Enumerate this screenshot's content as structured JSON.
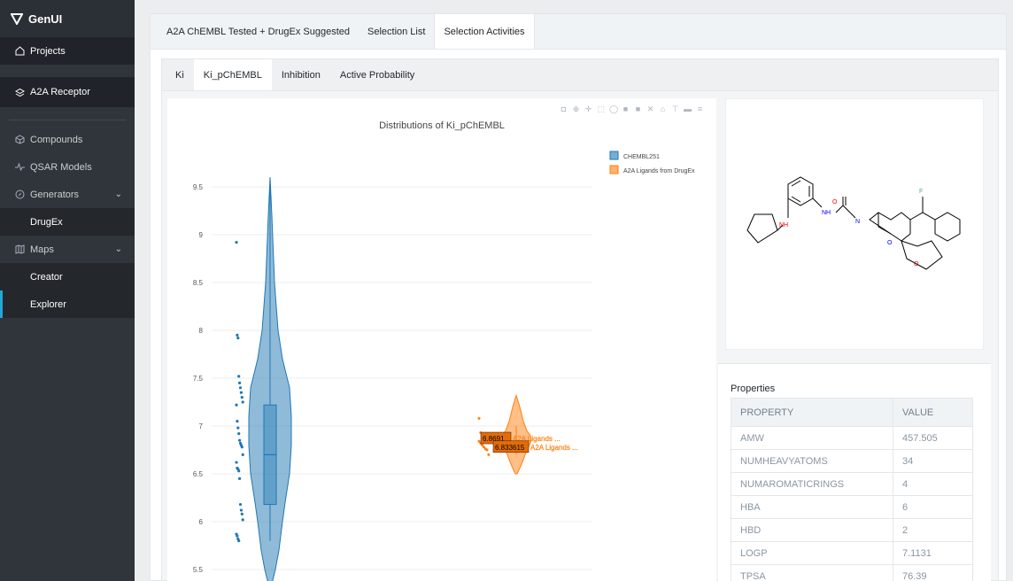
{
  "app": {
    "name": "GenUI"
  },
  "sidebar": {
    "projects": "Projects",
    "project_name": "A2A Receptor",
    "compounds": "Compounds",
    "qsar": "QSAR Models",
    "generators": "Generators",
    "drugex": "DrugEx",
    "maps": "Maps",
    "creator": "Creator",
    "explorer": "Explorer"
  },
  "tabs": [
    "A2A ChEMBL Tested + DrugEx Suggested",
    "Selection List",
    "Selection Activities"
  ],
  "subtabs": [
    "Ki",
    "Ki_pChEMBL",
    "Inhibition",
    "Active Probability"
  ],
  "icons": {
    "brand": "triangle-logo-icon",
    "projects": "home-icon",
    "project": "layers-icon",
    "compounds": "cube-icon",
    "qsar": "activity-icon",
    "generators": "compass-icon",
    "maps": "map-icon"
  },
  "colors": {
    "blue": "#1f77b4",
    "orange": "#ff7f0e",
    "accent": "#20a8d8"
  },
  "chart_data": {
    "type": "violin",
    "title": "Distributions of Ki_pChEMBL",
    "y_ticks": [
      "9.5",
      "9",
      "8.5",
      "8",
      "7.5",
      "7",
      "6.5",
      "6",
      "5.5"
    ],
    "legend": [
      "CHEMBL251",
      "A2A Ligands from DrugEx"
    ],
    "series": [
      {
        "name": "CHEMBL251",
        "points": [
          8.92,
          7.95,
          7.92,
          7.52,
          7.45,
          7.4,
          7.35,
          7.3,
          7.25,
          7.22,
          7.05,
          6.98,
          6.92,
          6.85,
          6.82,
          6.8,
          6.78,
          6.7,
          6.62,
          6.56,
          6.55,
          6.53,
          6.45,
          6.18,
          6.12,
          6.08,
          6.02,
          5.87,
          5.85,
          5.82,
          5.8
        ],
        "box": {
          "q1": 6.18,
          "median": 6.7,
          "q3": 7.22,
          "min": 5.8,
          "max": 9.6
        }
      },
      {
        "name": "A2A Ligands from DrugEx",
        "points": [
          7.08,
          6.93,
          6.9,
          6.88,
          6.87,
          6.86,
          6.85,
          6.84,
          6.82,
          6.8,
          6.78,
          6.76,
          6.75,
          6.7
        ],
        "annotations": [
          {
            "value": "6.8691",
            "label": "A2A Ligands ..."
          },
          {
            "value": "6.833615",
            "label": "A2A Ligands ..."
          }
        ]
      }
    ]
  },
  "properties": {
    "title": "Properties",
    "headers": [
      "PROPERTY",
      "VALUE"
    ],
    "rows": [
      [
        "AMW",
        "457.505"
      ],
      [
        "NUMHEAVYATOMS",
        "34"
      ],
      [
        "NUMAROMATICRINGS",
        "4"
      ],
      [
        "HBA",
        "6"
      ],
      [
        "HBD",
        "2"
      ],
      [
        "LOGP",
        "7.1131"
      ],
      [
        "TPSA",
        "76.39"
      ]
    ]
  },
  "molecule": {
    "atom_labels": [
      "F",
      "O",
      "NH",
      "NH",
      "N",
      "O",
      "O"
    ]
  }
}
